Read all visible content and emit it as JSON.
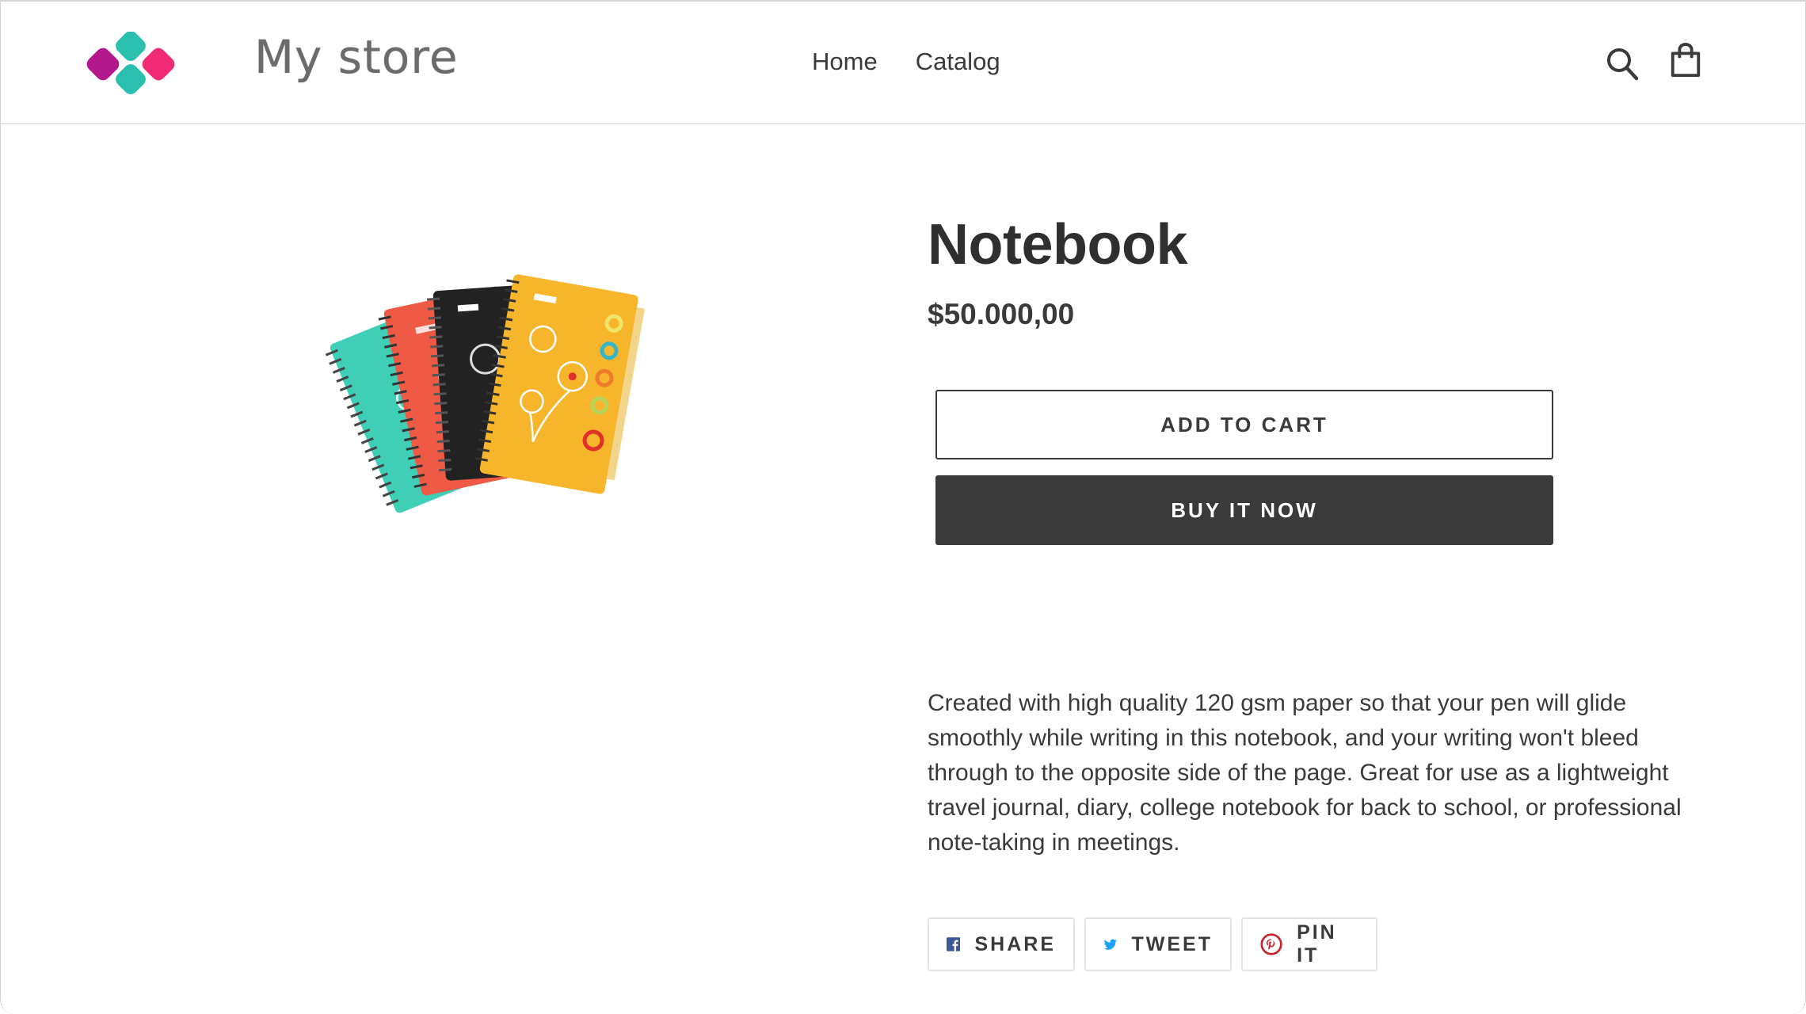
{
  "store": {
    "name": "My store"
  },
  "nav": {
    "items": [
      {
        "label": "Home"
      },
      {
        "label": "Catalog"
      }
    ]
  },
  "header_icons": {
    "search": "search-icon",
    "cart": "cart-icon"
  },
  "product": {
    "image_icon": "notebook-product-image",
    "title": "Notebook",
    "price": "$50.000,00",
    "add_to_cart_label": "ADD TO CART",
    "buy_now_label": "BUY IT NOW",
    "description": "Created with high quality 120 gsm paper so that your pen will glide smoothly while writing in this notebook, and your writing won't bleed through to the opposite side of the page. Great for use as a lightweight travel journal, diary, college notebook for back to school, or professional note-taking in meetings."
  },
  "share": {
    "facebook_label": "SHARE",
    "twitter_label": "TWEET",
    "pinterest_label": "PIN IT"
  },
  "colors": {
    "text": "#3a3a3a",
    "button_dark": "#3a3a3a",
    "facebook": "#3b5998",
    "twitter": "#1da1f2",
    "pinterest": "#cb2027",
    "logo_teal": "#2bbfae",
    "logo_magenta": "#b2178b",
    "logo_pink": "#f02a74"
  }
}
